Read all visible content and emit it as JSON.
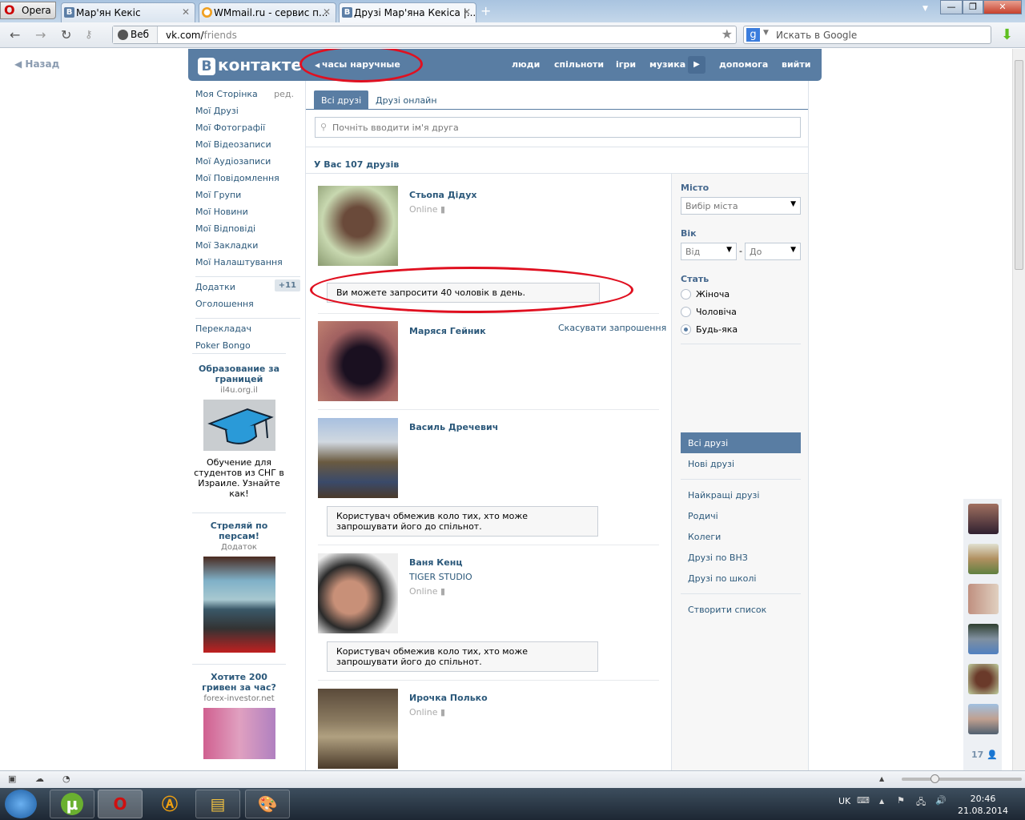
{
  "browser": {
    "menu_label": "Opera",
    "tabs": [
      {
        "label": "Мар'ян Кекіс",
        "favicon": "В"
      },
      {
        "label": "WMmail.ru - сервис п...",
        "favicon": "●"
      },
      {
        "label": "Друзі Мар'яна Кекіса |...",
        "favicon": "В"
      }
    ],
    "address": {
      "scope": "Веб",
      "host": "vk.com/",
      "path": "friends"
    },
    "search_placeholder": "Искать в Google",
    "search_engine": "g",
    "window_controls": {
      "minimize": "—",
      "restore": "❐",
      "close": "✕"
    }
  },
  "page": {
    "back_label": "Назад",
    "header": {
      "logo_letter": "В",
      "logo_text": "контакте",
      "status": "часы наручные",
      "nav": [
        "люди",
        "спільноти",
        "ігри",
        "музика",
        "допомога",
        "вийти"
      ],
      "brand_color": "#597da3"
    },
    "sidebar": {
      "edit_label": "ред.",
      "items": [
        "Моя Сторінка",
        "Мої Друзі",
        "Мої Фотографії",
        "Мої Відеозаписи",
        "Мої Аудіозаписи",
        "Мої Повідомлення",
        "Мої Групи",
        "Мої Новини",
        "Мої Відповіді",
        "Мої Закладки",
        "Мої Налаштування"
      ],
      "apps": {
        "label": "Додатки",
        "badge": "+11"
      },
      "ads_label": "Оголошення",
      "extra": [
        "Перекладач",
        "Poker Bongo"
      ]
    },
    "ads": [
      {
        "title": "Образование за границей",
        "domain": "il4u.org.il",
        "text": "Обучение для студентов из СНГ в Израиле. Узнайте как!"
      },
      {
        "title": "Стреляй по персам!",
        "domain": "Додаток"
      },
      {
        "title": "Хотите 200 гривен за час?",
        "domain": "forex-investor.net"
      }
    ],
    "friends": {
      "tabs": [
        "Всі друзі",
        "Друзі онлайн"
      ],
      "search_placeholder": "Почніть вводити ім'я друга",
      "count_label": "У Вас 107 друзів",
      "invite_limit_notice": "Ви можете запросити 40 чоловік в день.",
      "cancel_invite": "Скасувати запрошення",
      "restricted_notice": "Користувач обмежив коло тих, хто може запрошувати його до спільнот.",
      "list": [
        {
          "name": "Стьопа Дідух",
          "status": "Online"
        },
        {
          "name": "Маряся Гейник"
        },
        {
          "name": "Василь Дречевич"
        },
        {
          "name": "Ваня Кенц",
          "subtitle": "TIGER STUDIO",
          "status": "Online"
        },
        {
          "name": "Ирочка Полько",
          "status": "Online"
        }
      ]
    },
    "filters": {
      "city_label": "Місто",
      "city_value": "Вибір міста",
      "age_label": "Вік",
      "age_from": "Від",
      "age_dash": "-",
      "age_to": "До",
      "gender_label": "Стать",
      "genders": [
        "Жіноча",
        "Чоловіча",
        "Будь-яка"
      ],
      "gender_selected": "Будь-яка",
      "lists_a": [
        "Всі друзі",
        "Нові друзі"
      ],
      "lists_b": [
        "Найкращі друзі",
        "Родичі",
        "Колеги",
        "Друзі по ВНЗ",
        "Друзі по школі"
      ],
      "create_list": "Створити список"
    },
    "chat": {
      "count": "17"
    }
  },
  "taskbar": {
    "lang": "UK",
    "time": "20:46",
    "date": "21.08.2014"
  }
}
